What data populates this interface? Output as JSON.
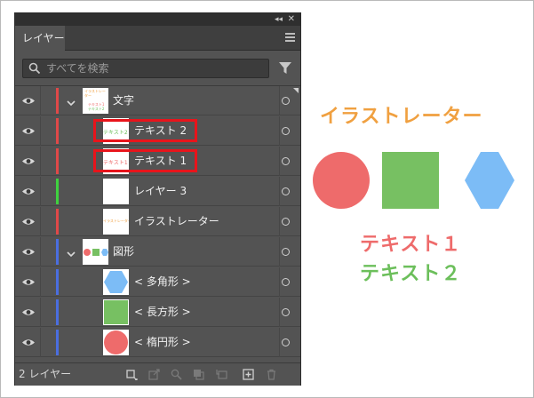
{
  "panel": {
    "tab_label": "レイヤー",
    "collapse_glyph": "◂◂",
    "close_glyph": "✕",
    "search_placeholder": "すべてを検索",
    "footer_count": "2 レイヤー"
  },
  "layers": [
    {
      "name": "文字",
      "color": "#e04848",
      "expanded": true,
      "indent": 0,
      "thumb": "text-mini"
    },
    {
      "name": "テキスト 2",
      "color": "#e04848",
      "indent": 1,
      "thumb": "text2-mini",
      "highlighted": true
    },
    {
      "name": "テキスト 1",
      "color": "#e04848",
      "indent": 1,
      "thumb": "text1-mini",
      "highlighted": true
    },
    {
      "name": "レイヤー 3",
      "color": "#3fd13f",
      "indent": 1,
      "thumb": "blank"
    },
    {
      "name": "イラストレーター",
      "color": "#e04848",
      "indent": 1,
      "thumb": "illustrator-mini"
    },
    {
      "name": "図形",
      "color": "#4a6ee0",
      "expanded": true,
      "indent": 0,
      "thumb": "shapes-mini"
    },
    {
      "name": "< 多角形 >",
      "color": "#4a6ee0",
      "indent": 1,
      "thumb": "hexagon"
    },
    {
      "name": "< 長方形 >",
      "color": "#4a6ee0",
      "indent": 1,
      "thumb": "square"
    },
    {
      "name": "< 楕円形 >",
      "color": "#4a6ee0",
      "indent": 1,
      "thumb": "circle"
    }
  ],
  "thumb_text": {
    "illustrator": "イラストレーター",
    "text1": "テキスト1",
    "text2": "テキスト2"
  },
  "artwork": {
    "title": "イラストレーター",
    "text1": "テキスト１",
    "text2": "テキスト２",
    "colors": {
      "title": "#f0a040",
      "circle": "#ee6b6b",
      "square": "#77c062",
      "hexagon": "#7cbcf6",
      "text1": "#ee6b6b",
      "text2": "#6cbf5b"
    }
  }
}
